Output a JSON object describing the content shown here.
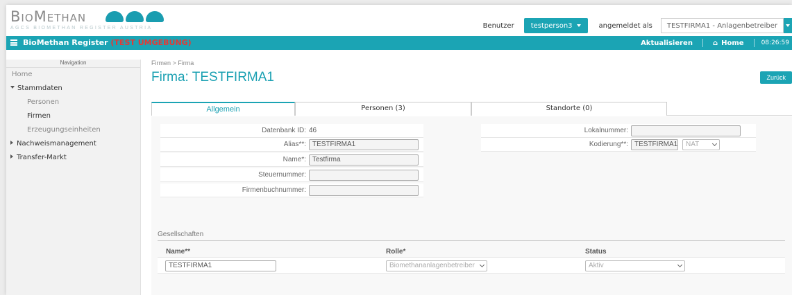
{
  "header": {
    "logo_text": "BioMethan",
    "logo_subtitle": "AGCS BioMethan Register Austria",
    "user_label": "Benutzer",
    "user_name": "testperson3",
    "logged_in_label": "angemeldet als",
    "company_role": "TESTFIRMA1 - Anlagenbetreiber"
  },
  "navbar": {
    "brand": "BioMethan Register",
    "env": "(TEST UMGEBUNG)",
    "refresh": "Aktualisieren",
    "home": "Home",
    "clock": "08:26:59"
  },
  "sidebar": {
    "heading": "Navigation",
    "items": [
      {
        "label": "Home"
      },
      {
        "label": "Stammdaten"
      },
      {
        "label": "Personen"
      },
      {
        "label": "Firmen"
      },
      {
        "label": "Erzeugungseinheiten"
      },
      {
        "label": "Nachweismanagement"
      },
      {
        "label": "Transfer-Markt"
      }
    ]
  },
  "breadcrumb": "Firmen > Firma",
  "page_title": "Firma: TESTFIRMA1",
  "back_button": "Zurück",
  "tabs": [
    {
      "label": "Allgemein"
    },
    {
      "label": "Personen (3)"
    },
    {
      "label": "Standorte (0)"
    }
  ],
  "form": {
    "db_id_label": "Datenbank ID:",
    "db_id_value": "46",
    "alias_label": "Alias**:",
    "alias_value": "TESTFIRMA1",
    "name_label": "Name*:",
    "name_value": "Testfirma",
    "tax_label": "Steuernummer:",
    "tax_value": "",
    "register_label": "Firmenbuchnummer:",
    "register_value": "",
    "local_label": "Lokalnummer:",
    "local_value": "",
    "coding_label": "Kodierung**:",
    "coding_value": "TESTFIRMA1",
    "coding_select": "NAT"
  },
  "companies": {
    "title": "Gesellschaften",
    "col_name": "Name**",
    "col_role": "Rolle*",
    "col_status": "Status",
    "row_name": "TESTFIRMA1",
    "row_role": "Biomethananlagenbetreiber",
    "row_status": "Aktiv"
  },
  "colors": {
    "accent": "#1ba4b4",
    "env_text": "#e53935"
  },
  "icons": [
    "menu-icon",
    "home-icon",
    "caret-down-icon",
    "chevron-down-icon"
  ]
}
